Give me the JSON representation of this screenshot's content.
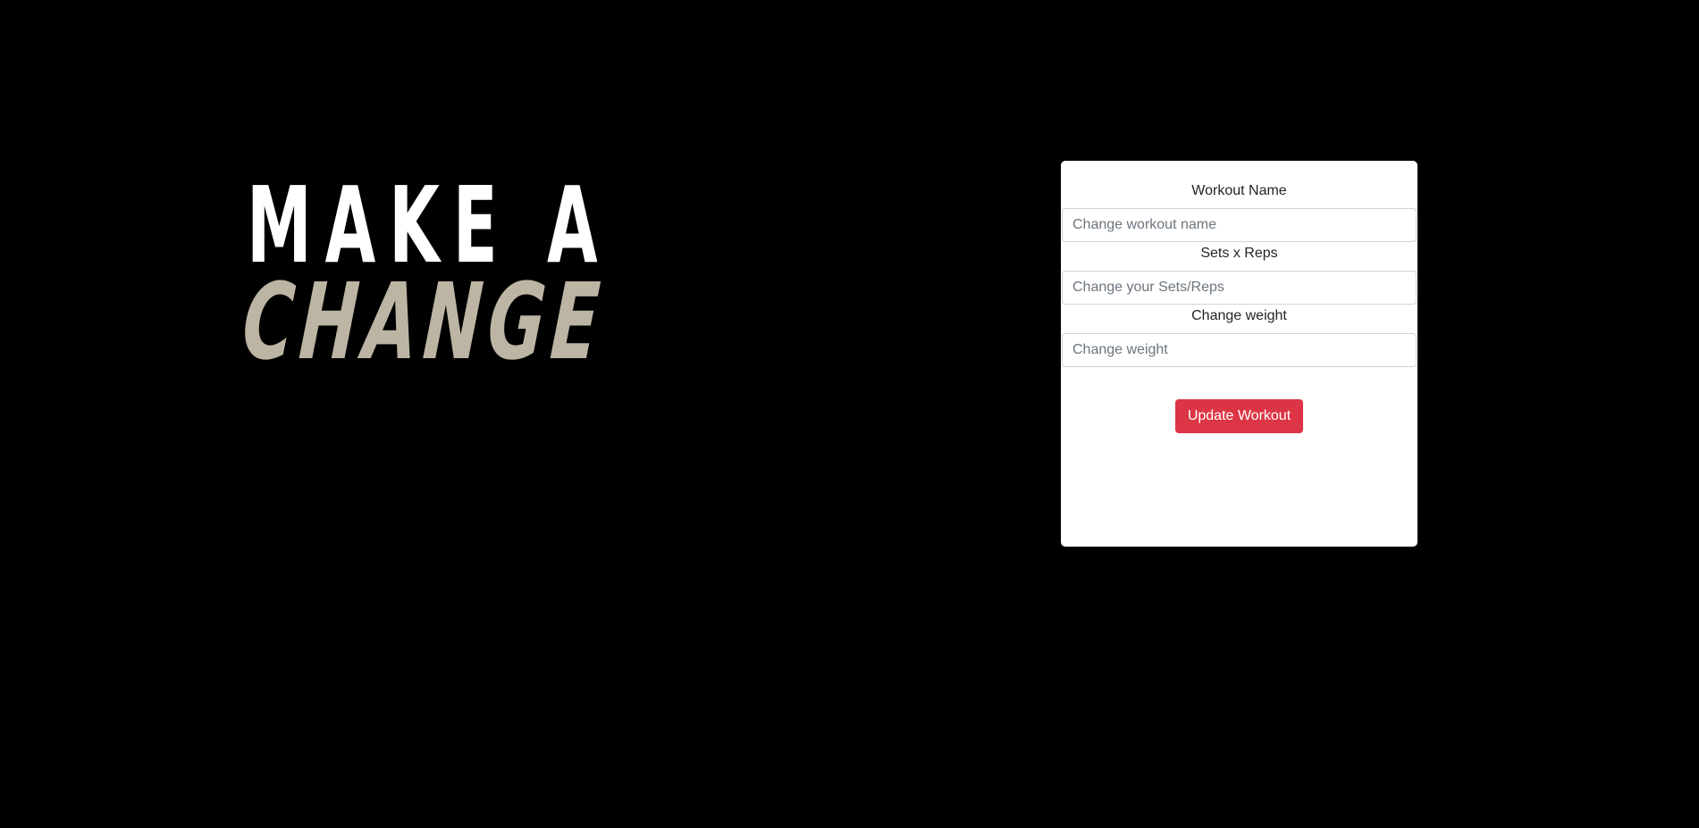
{
  "hero": {
    "line1": "MAKE A",
    "line2": "CHANGE"
  },
  "colors": {
    "background": "#000000",
    "hero_line1": "#ffffff",
    "hero_line2": "#bdb5a4",
    "card": "#ffffff",
    "button": "#dc3545"
  },
  "form": {
    "workout_name": {
      "label": "Workout Name",
      "placeholder": "Change workout name",
      "value": ""
    },
    "sets_reps": {
      "label": "Sets x Reps",
      "placeholder": "Change your Sets/Reps",
      "value": ""
    },
    "weight": {
      "label": "Change weight",
      "placeholder": "Change weight",
      "value": ""
    },
    "submit_label": "Update Workout"
  }
}
